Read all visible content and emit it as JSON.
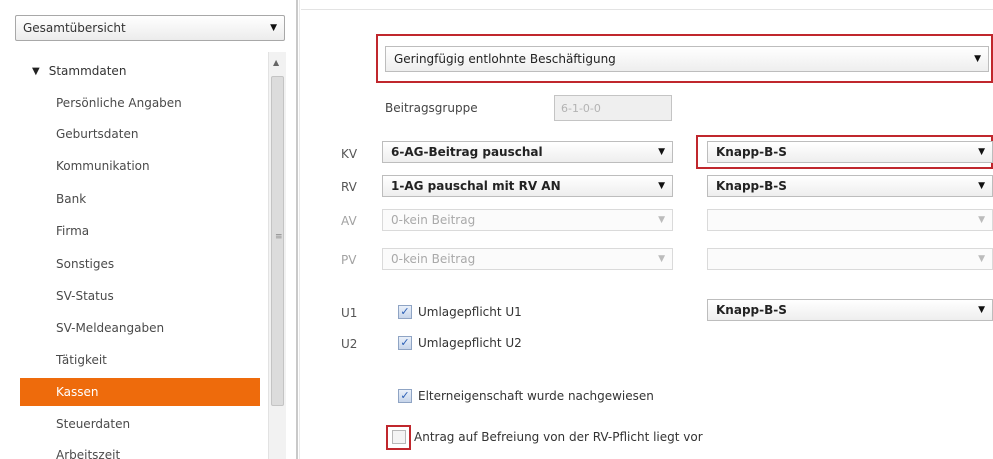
{
  "nav": {
    "overview_select": "Gesamtübersicht",
    "group_label": "Stammdaten",
    "items": [
      "Persönliche Angaben",
      "Geburtsdaten",
      "Kommunikation",
      "Bank",
      "Firma",
      "Sonstiges",
      "SV-Status",
      "SV-Meldeangaben",
      "Tätigkeit",
      "Kassen",
      "Steuerdaten",
      "Arbeitszeit"
    ],
    "active_item": "Kassen"
  },
  "form": {
    "employment_type": "Geringfügig entlohnte Beschäftigung",
    "beitragsgruppe_label": "Beitragsgruppe",
    "beitragsgruppe_value": "6-1-0-0",
    "rows": [
      {
        "label": "KV",
        "value": "6-AG-Beitrag pauschal",
        "kasse": "Knapp-B-S"
      },
      {
        "label": "RV",
        "value": "1-AG pauschal mit RV AN",
        "kasse": "Knapp-B-S"
      },
      {
        "label": "AV",
        "value": "0-kein Beitrag",
        "kasse": ""
      },
      {
        "label": "PV",
        "value": "0-kein Beitrag",
        "kasse": ""
      }
    ],
    "u1": {
      "label": "U1",
      "checkbox_label": "Umlagepflicht U1",
      "checked": true,
      "kasse": "Knapp-B-S"
    },
    "u2": {
      "label": "U2",
      "checkbox_label": "Umlagepflicht U2",
      "checked": true
    },
    "elterneigenschaft": {
      "label": "Elterneigenschaft wurde nachgewiesen",
      "checked": true
    },
    "antrag": {
      "label": "Antrag auf Befreiung von der RV-Pflicht liegt vor",
      "checked": false
    }
  },
  "icons": {
    "dropdown": "chevron-down-icon",
    "expand": "triangle-down-icon",
    "check": "check-icon"
  },
  "colors": {
    "active_nav": "#ee6b0c",
    "highlight": "#c0272d"
  }
}
